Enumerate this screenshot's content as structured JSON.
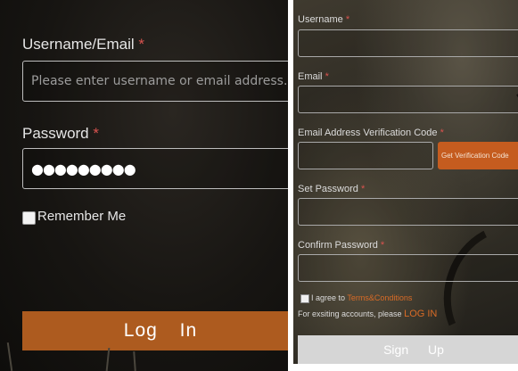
{
  "login": {
    "username_label": "Username/Email",
    "required_mark": "*",
    "username_placeholder": "Please enter username or email address.",
    "password_label": "Password",
    "password_value": "●●●●●●●●●",
    "remember_label": "Remember Me",
    "login_button": "Log In",
    "accent_color": "#ad5b1f"
  },
  "signup": {
    "username_label": "Username",
    "email_label": "Email",
    "verification_label": "Email Address Verification Code",
    "get_code_button": "Get Verification Code",
    "set_password_label": "Set Password",
    "confirm_password_label": "Confirm Password",
    "agree_prefix": "I agree to",
    "terms_link": "Terms&Conditions",
    "existing_prefix": "For exsiting accounts, please",
    "login_link": "LOG IN",
    "signup_button": "Sign Up",
    "required_mark": "*",
    "accent_color": "#c55c1f"
  }
}
